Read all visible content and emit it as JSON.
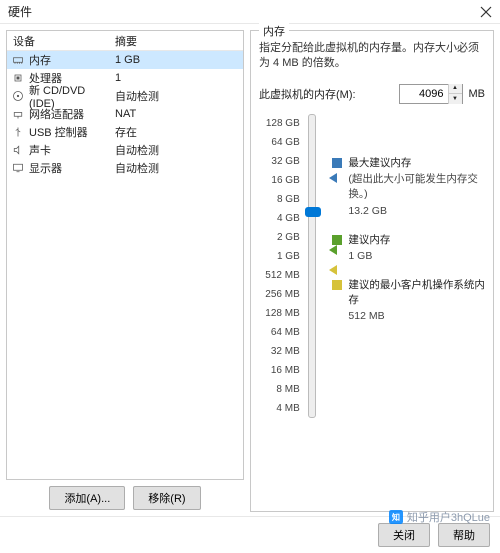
{
  "title": "硬件",
  "headers": {
    "device": "设备",
    "summary": "摘要"
  },
  "devices": [
    {
      "icon": "memory",
      "label": "内存",
      "summary": "1 GB",
      "selected": true
    },
    {
      "icon": "cpu",
      "label": "处理器",
      "summary": "1"
    },
    {
      "icon": "disc",
      "label": "新 CD/DVD (IDE)",
      "summary": "自动检测"
    },
    {
      "icon": "network",
      "label": "网络适配器",
      "summary": "NAT"
    },
    {
      "icon": "usb",
      "label": "USB 控制器",
      "summary": "存在"
    },
    {
      "icon": "sound",
      "label": "声卡",
      "summary": "自动检测"
    },
    {
      "icon": "display",
      "label": "显示器",
      "summary": "自动检测"
    }
  ],
  "buttons": {
    "add": "添加(A)...",
    "remove": "移除(R)",
    "close": "关闭",
    "help": "帮助"
  },
  "right": {
    "section": "内存",
    "desc": "指定分配给此虚拟机的内存量。内存大小必须为 4 MB 的倍数。",
    "input_label": "此虚拟机的内存(M):",
    "value": "4096",
    "unit": "MB",
    "ticks": [
      "128 GB",
      "64 GB",
      "32 GB",
      "16 GB",
      "8 GB",
      "4 GB",
      "2 GB",
      "1 GB",
      "512 MB",
      "256 MB",
      "128 MB",
      "64 MB",
      "32 MB",
      "16 MB",
      "8 MB",
      "4 MB"
    ],
    "legend": {
      "max": {
        "title": "最大建议内存",
        "note": "(超出此大小可能发生内存交换。)",
        "value": "13.2 GB"
      },
      "rec": {
        "title": "建议内存",
        "value": "1 GB"
      },
      "min": {
        "title": "建议的最小客户机操作系统内存",
        "value": "512 MB"
      }
    }
  },
  "watermark": "知乎用户3hQLue"
}
